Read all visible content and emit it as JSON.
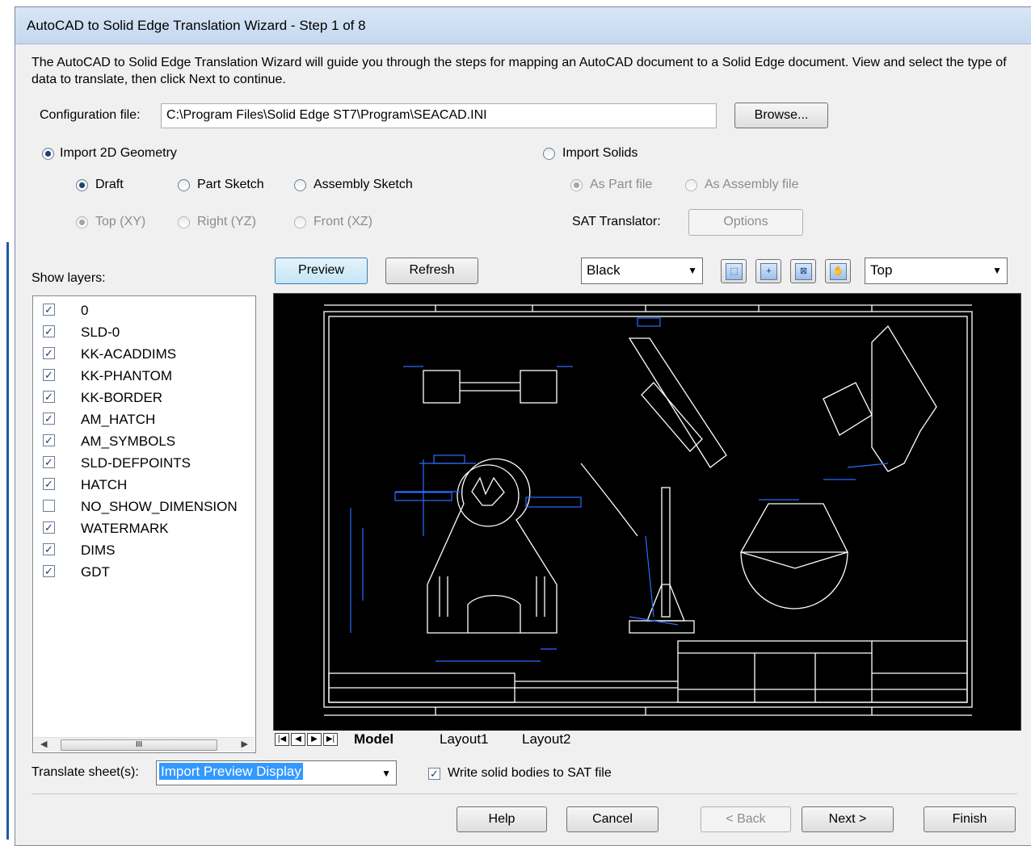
{
  "dialog": {
    "title": "AutoCAD to Solid Edge Translation Wizard - Step 1 of 8",
    "intro": "The AutoCAD to Solid Edge Translation  Wizard will guide you through the steps for mapping an AutoCAD document to a Solid Edge document.  View and select the type of data to translate, then click Next to continue."
  },
  "config": {
    "label": "Configuration file:",
    "value": "C:\\Program Files\\Solid Edge ST7\\Program\\SEACAD.INI",
    "browse": "Browse..."
  },
  "import2d": {
    "label": "Import 2D Geometry",
    "selected": true,
    "draft": "Draft",
    "part_sketch": "Part Sketch",
    "assembly_sketch": "Assembly Sketch",
    "top": "Top (XY)",
    "right": "Right (YZ)",
    "front": "Front (XZ)"
  },
  "solids": {
    "label": "Import Solids",
    "as_part": "As Part file",
    "as_assembly": "As Assembly file",
    "sat_label": "SAT Translator:",
    "options": "Options"
  },
  "layers": {
    "label": "Show layers:",
    "items": [
      {
        "name": "0",
        "checked": true
      },
      {
        "name": "SLD-0",
        "checked": true
      },
      {
        "name": "KK-ACADDIMS",
        "checked": true
      },
      {
        "name": "KK-PHANTOM",
        "checked": true
      },
      {
        "name": "KK-BORDER",
        "checked": true
      },
      {
        "name": "AM_HATCH",
        "checked": true
      },
      {
        "name": "AM_SYMBOLS",
        "checked": true
      },
      {
        "name": "SLD-DEFPOINTS",
        "checked": true
      },
      {
        "name": "HATCH",
        "checked": true
      },
      {
        "name": "NO_SHOW_DIMENSION",
        "checked": false
      },
      {
        "name": "WATERMARK",
        "checked": true
      },
      {
        "name": "DIMS",
        "checked": true
      },
      {
        "name": "GDT",
        "checked": true
      }
    ],
    "scroll_thumb": "III"
  },
  "toolbar": {
    "preview": "Preview",
    "refresh": "Refresh",
    "color": "Black",
    "view": "Top",
    "icons": [
      "zoom-window-icon",
      "zoom-icon",
      "fit-icon",
      "pan-icon"
    ]
  },
  "sheet_tabs": {
    "items": [
      "Model",
      "Layout1",
      "Layout2"
    ],
    "active": "Model"
  },
  "translate": {
    "label": "Translate sheet(s):",
    "value": "Import Preview Display",
    "write_sat": "Write solid bodies to SAT file",
    "write_sat_checked": true
  },
  "buttons": {
    "help": "Help",
    "cancel": "Cancel",
    "back": "< Back",
    "next": "Next >",
    "finish": "Finish"
  },
  "colors": {
    "drawing_bg": "#000000",
    "drawing_lines": "#ffffff",
    "dimension_lines": "#2b6bff",
    "title_gradient": "#c4d8ef"
  }
}
